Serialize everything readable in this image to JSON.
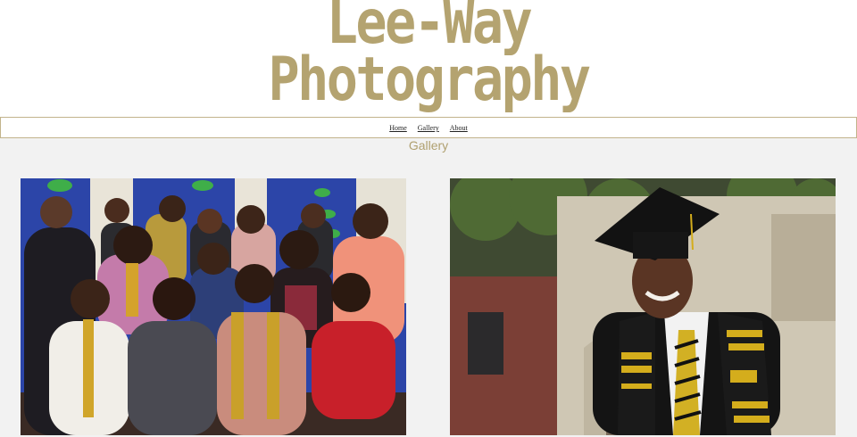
{
  "site": {
    "title_line1": "Lee-Way",
    "title_line2": "Photography",
    "brand_color": "#b4a370"
  },
  "nav": {
    "items": [
      {
        "label": "Home"
      },
      {
        "label": "Gallery"
      },
      {
        "label": "About"
      }
    ]
  },
  "page": {
    "heading": "Gallery"
  },
  "gallery": {
    "photos": [
      {
        "subject": "group-portrait"
      },
      {
        "subject": "graduate-portrait"
      }
    ]
  }
}
